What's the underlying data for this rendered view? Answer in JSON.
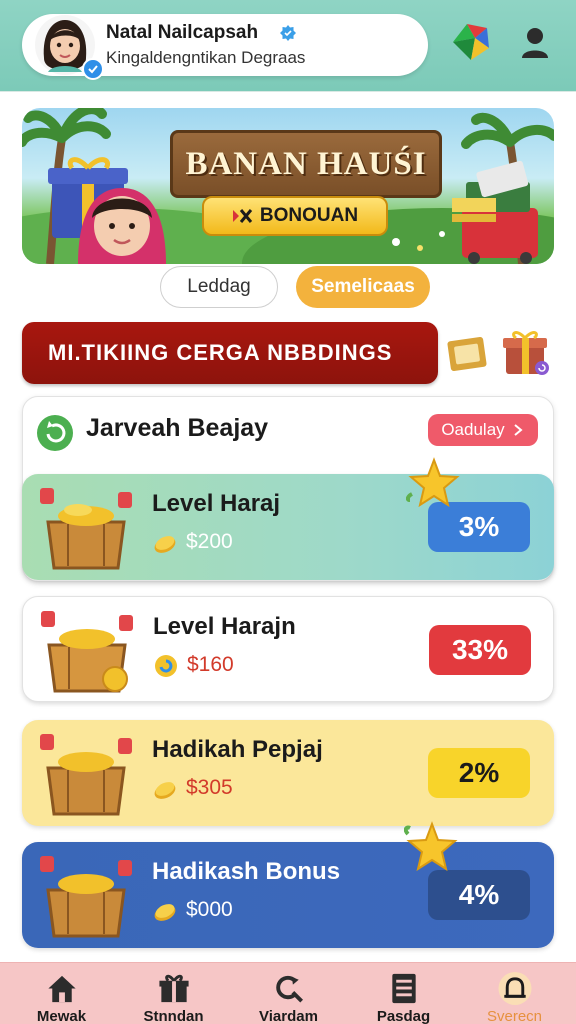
{
  "header": {
    "name": "Natal Nailcapsah",
    "subtitle": "Kingaldengntikan Degraas",
    "icons": [
      "avatar",
      "verified-icon",
      "app-logo-icon",
      "user-icon"
    ]
  },
  "banner": {
    "title": "BANAN HAUŚI",
    "button_label": "BONOUAN"
  },
  "tabs": [
    {
      "label": "Leddag",
      "active": false
    },
    {
      "label": "Semelicaas",
      "active": true
    }
  ],
  "promo": {
    "text": "MI.TIKIING CERGA NBBDINGS"
  },
  "panel": {
    "title": "Jarveah Beajay",
    "schedule_label": "Oadulay"
  },
  "rewards": [
    {
      "title": "Level Haraj",
      "amount": "$200",
      "percent": "3%",
      "color": "#3b7ed8"
    },
    {
      "title": "Level Harajn",
      "amount": "$160",
      "percent": "33%",
      "color": "#e23a3e"
    },
    {
      "title": "Hadikah Pepjaj",
      "amount": "$305",
      "percent": "2%",
      "color": "#f8d42a"
    },
    {
      "title": "Hadikash Bonus",
      "amount": "$000",
      "percent": "4%",
      "color": "#2d4f8e"
    }
  ],
  "nav": [
    {
      "label": "Mewak",
      "icon": "home-icon"
    },
    {
      "label": "Stnndan",
      "icon": "gift-box-icon"
    },
    {
      "label": "Viardam",
      "icon": "search-icon"
    },
    {
      "label": "Pasdag",
      "icon": "list-icon"
    },
    {
      "label": "Sverecn",
      "icon": "bell-icon",
      "active": true
    }
  ]
}
